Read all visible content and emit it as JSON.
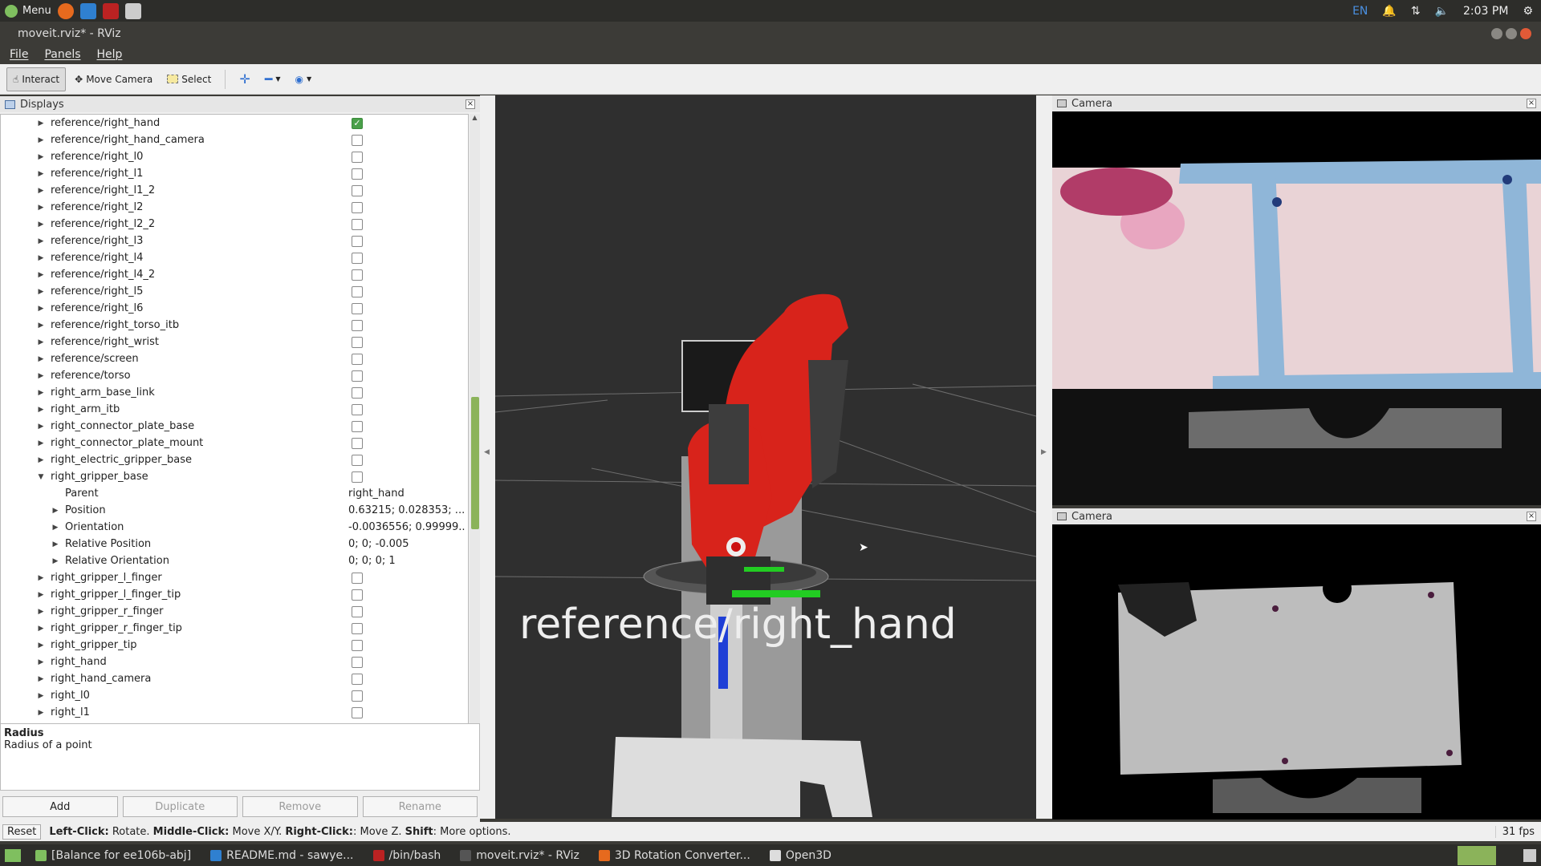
{
  "topbar": {
    "menu_label": "Menu",
    "lang": "EN",
    "time": "2:03 PM"
  },
  "window": {
    "title": "moveit.rviz* - RViz"
  },
  "menubar": {
    "file": "File",
    "panels": "Panels",
    "help": "Help"
  },
  "toolbar": {
    "interact": "Interact",
    "move_camera": "Move Camera",
    "select": "Select"
  },
  "displays": {
    "title": "Displays",
    "rows": [
      {
        "label": "reference/right_hand",
        "checked": true
      },
      {
        "label": "reference/right_hand_camera"
      },
      {
        "label": "reference/right_l0"
      },
      {
        "label": "reference/right_l1"
      },
      {
        "label": "reference/right_l1_2"
      },
      {
        "label": "reference/right_l2"
      },
      {
        "label": "reference/right_l2_2"
      },
      {
        "label": "reference/right_l3"
      },
      {
        "label": "reference/right_l4"
      },
      {
        "label": "reference/right_l4_2"
      },
      {
        "label": "reference/right_l5"
      },
      {
        "label": "reference/right_l6"
      },
      {
        "label": "reference/right_torso_itb"
      },
      {
        "label": "reference/right_wrist"
      },
      {
        "label": "reference/screen"
      },
      {
        "label": "reference/torso"
      },
      {
        "label": "right_arm_base_link"
      },
      {
        "label": "right_arm_itb"
      },
      {
        "label": "right_connector_plate_base"
      },
      {
        "label": "right_connector_plate_mount"
      },
      {
        "label": "right_electric_gripper_base"
      },
      {
        "label": "right_gripper_base",
        "expanded": true
      },
      {
        "label": "Parent",
        "child": true,
        "value": "right_hand",
        "noarrow": true
      },
      {
        "label": "Position",
        "child": true,
        "value": "0.63215; 0.028353; ..."
      },
      {
        "label": "Orientation",
        "child": true,
        "value": "-0.0036556; 0.99999..."
      },
      {
        "label": "Relative Position",
        "child": true,
        "value": "0; 0; -0.005"
      },
      {
        "label": "Relative Orientation",
        "child": true,
        "value": "0; 0; 0; 1"
      },
      {
        "label": "right_gripper_l_finger"
      },
      {
        "label": "right_gripper_l_finger_tip"
      },
      {
        "label": "right_gripper_r_finger"
      },
      {
        "label": "right_gripper_r_finger_tip"
      },
      {
        "label": "right_gripper_tip"
      },
      {
        "label": "right_hand"
      },
      {
        "label": "right_hand_camera"
      },
      {
        "label": "right_l0"
      },
      {
        "label": "right_l1"
      }
    ],
    "desc_title": "Radius",
    "desc_text": "Radius of a point",
    "buttons": {
      "add": "Add",
      "duplicate": "Duplicate",
      "remove": "Remove",
      "rename": "Rename"
    }
  },
  "view3d": {
    "frame_label": "reference/right_hand"
  },
  "camera_panels": [
    {
      "title": "Camera"
    },
    {
      "title": "Camera"
    }
  ],
  "status": {
    "reset": "Reset",
    "msg_b1": "Left-Click:",
    "msg_t1": " Rotate. ",
    "msg_b2": "Middle-Click:",
    "msg_t2": " Move X/Y. ",
    "msg_b3": "Right-Click:",
    "msg_t3": ": Move Z. ",
    "msg_b4": "Shift",
    "msg_t4": ": More options.",
    "fps": "31 fps"
  },
  "taskbar": [
    {
      "label": "[Balance for ee106b-abj]",
      "color": "#7fbf5f"
    },
    {
      "label": "README.md - sawye...",
      "color": "#2f80d0"
    },
    {
      "label": "/bin/bash",
      "color": "#b22"
    },
    {
      "label": "moveit.rviz* - RViz",
      "color": "#555"
    },
    {
      "label": "3D Rotation Converter...",
      "color": "#e66a1e"
    },
    {
      "label": "Open3D",
      "color": "#ddd"
    }
  ],
  "colors": {
    "accent": "#8bb35a",
    "robot": "#d8231b"
  }
}
